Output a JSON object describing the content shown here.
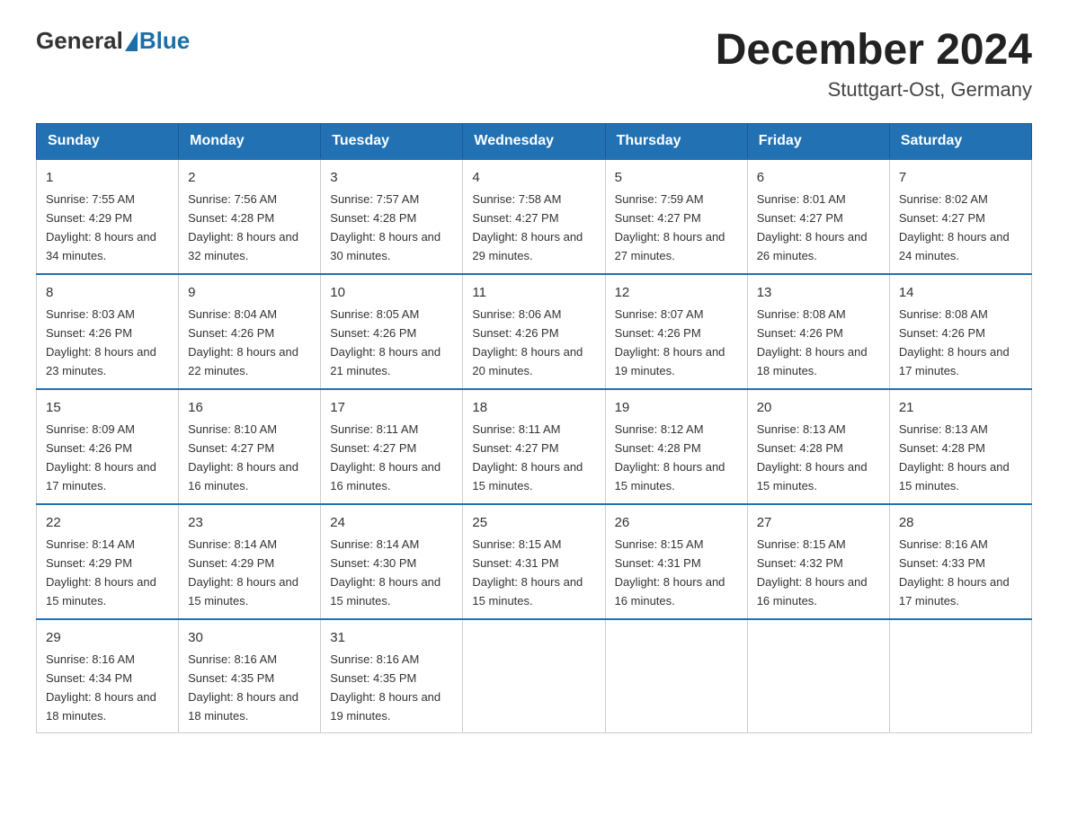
{
  "header": {
    "logo_general": "General",
    "logo_blue": "Blue",
    "month_title": "December 2024",
    "location": "Stuttgart-Ost, Germany"
  },
  "calendar": {
    "days_of_week": [
      "Sunday",
      "Monday",
      "Tuesday",
      "Wednesday",
      "Thursday",
      "Friday",
      "Saturday"
    ],
    "weeks": [
      [
        {
          "day": "1",
          "sunrise": "7:55 AM",
          "sunset": "4:29 PM",
          "daylight": "8 hours and 34 minutes."
        },
        {
          "day": "2",
          "sunrise": "7:56 AM",
          "sunset": "4:28 PM",
          "daylight": "8 hours and 32 minutes."
        },
        {
          "day": "3",
          "sunrise": "7:57 AM",
          "sunset": "4:28 PM",
          "daylight": "8 hours and 30 minutes."
        },
        {
          "day": "4",
          "sunrise": "7:58 AM",
          "sunset": "4:27 PM",
          "daylight": "8 hours and 29 minutes."
        },
        {
          "day": "5",
          "sunrise": "7:59 AM",
          "sunset": "4:27 PM",
          "daylight": "8 hours and 27 minutes."
        },
        {
          "day": "6",
          "sunrise": "8:01 AM",
          "sunset": "4:27 PM",
          "daylight": "8 hours and 26 minutes."
        },
        {
          "day": "7",
          "sunrise": "8:02 AM",
          "sunset": "4:27 PM",
          "daylight": "8 hours and 24 minutes."
        }
      ],
      [
        {
          "day": "8",
          "sunrise": "8:03 AM",
          "sunset": "4:26 PM",
          "daylight": "8 hours and 23 minutes."
        },
        {
          "day": "9",
          "sunrise": "8:04 AM",
          "sunset": "4:26 PM",
          "daylight": "8 hours and 22 minutes."
        },
        {
          "day": "10",
          "sunrise": "8:05 AM",
          "sunset": "4:26 PM",
          "daylight": "8 hours and 21 minutes."
        },
        {
          "day": "11",
          "sunrise": "8:06 AM",
          "sunset": "4:26 PM",
          "daylight": "8 hours and 20 minutes."
        },
        {
          "day": "12",
          "sunrise": "8:07 AM",
          "sunset": "4:26 PM",
          "daylight": "8 hours and 19 minutes."
        },
        {
          "day": "13",
          "sunrise": "8:08 AM",
          "sunset": "4:26 PM",
          "daylight": "8 hours and 18 minutes."
        },
        {
          "day": "14",
          "sunrise": "8:08 AM",
          "sunset": "4:26 PM",
          "daylight": "8 hours and 17 minutes."
        }
      ],
      [
        {
          "day": "15",
          "sunrise": "8:09 AM",
          "sunset": "4:26 PM",
          "daylight": "8 hours and 17 minutes."
        },
        {
          "day": "16",
          "sunrise": "8:10 AM",
          "sunset": "4:27 PM",
          "daylight": "8 hours and 16 minutes."
        },
        {
          "day": "17",
          "sunrise": "8:11 AM",
          "sunset": "4:27 PM",
          "daylight": "8 hours and 16 minutes."
        },
        {
          "day": "18",
          "sunrise": "8:11 AM",
          "sunset": "4:27 PM",
          "daylight": "8 hours and 15 minutes."
        },
        {
          "day": "19",
          "sunrise": "8:12 AM",
          "sunset": "4:28 PM",
          "daylight": "8 hours and 15 minutes."
        },
        {
          "day": "20",
          "sunrise": "8:13 AM",
          "sunset": "4:28 PM",
          "daylight": "8 hours and 15 minutes."
        },
        {
          "day": "21",
          "sunrise": "8:13 AM",
          "sunset": "4:28 PM",
          "daylight": "8 hours and 15 minutes."
        }
      ],
      [
        {
          "day": "22",
          "sunrise": "8:14 AM",
          "sunset": "4:29 PM",
          "daylight": "8 hours and 15 minutes."
        },
        {
          "day": "23",
          "sunrise": "8:14 AM",
          "sunset": "4:29 PM",
          "daylight": "8 hours and 15 minutes."
        },
        {
          "day": "24",
          "sunrise": "8:14 AM",
          "sunset": "4:30 PM",
          "daylight": "8 hours and 15 minutes."
        },
        {
          "day": "25",
          "sunrise": "8:15 AM",
          "sunset": "4:31 PM",
          "daylight": "8 hours and 15 minutes."
        },
        {
          "day": "26",
          "sunrise": "8:15 AM",
          "sunset": "4:31 PM",
          "daylight": "8 hours and 16 minutes."
        },
        {
          "day": "27",
          "sunrise": "8:15 AM",
          "sunset": "4:32 PM",
          "daylight": "8 hours and 16 minutes."
        },
        {
          "day": "28",
          "sunrise": "8:16 AM",
          "sunset": "4:33 PM",
          "daylight": "8 hours and 17 minutes."
        }
      ],
      [
        {
          "day": "29",
          "sunrise": "8:16 AM",
          "sunset": "4:34 PM",
          "daylight": "8 hours and 18 minutes."
        },
        {
          "day": "30",
          "sunrise": "8:16 AM",
          "sunset": "4:35 PM",
          "daylight": "8 hours and 18 minutes."
        },
        {
          "day": "31",
          "sunrise": "8:16 AM",
          "sunset": "4:35 PM",
          "daylight": "8 hours and 19 minutes."
        },
        {
          "day": "",
          "sunrise": "",
          "sunset": "",
          "daylight": ""
        },
        {
          "day": "",
          "sunrise": "",
          "sunset": "",
          "daylight": ""
        },
        {
          "day": "",
          "sunrise": "",
          "sunset": "",
          "daylight": ""
        },
        {
          "day": "",
          "sunrise": "",
          "sunset": "",
          "daylight": ""
        }
      ]
    ]
  }
}
